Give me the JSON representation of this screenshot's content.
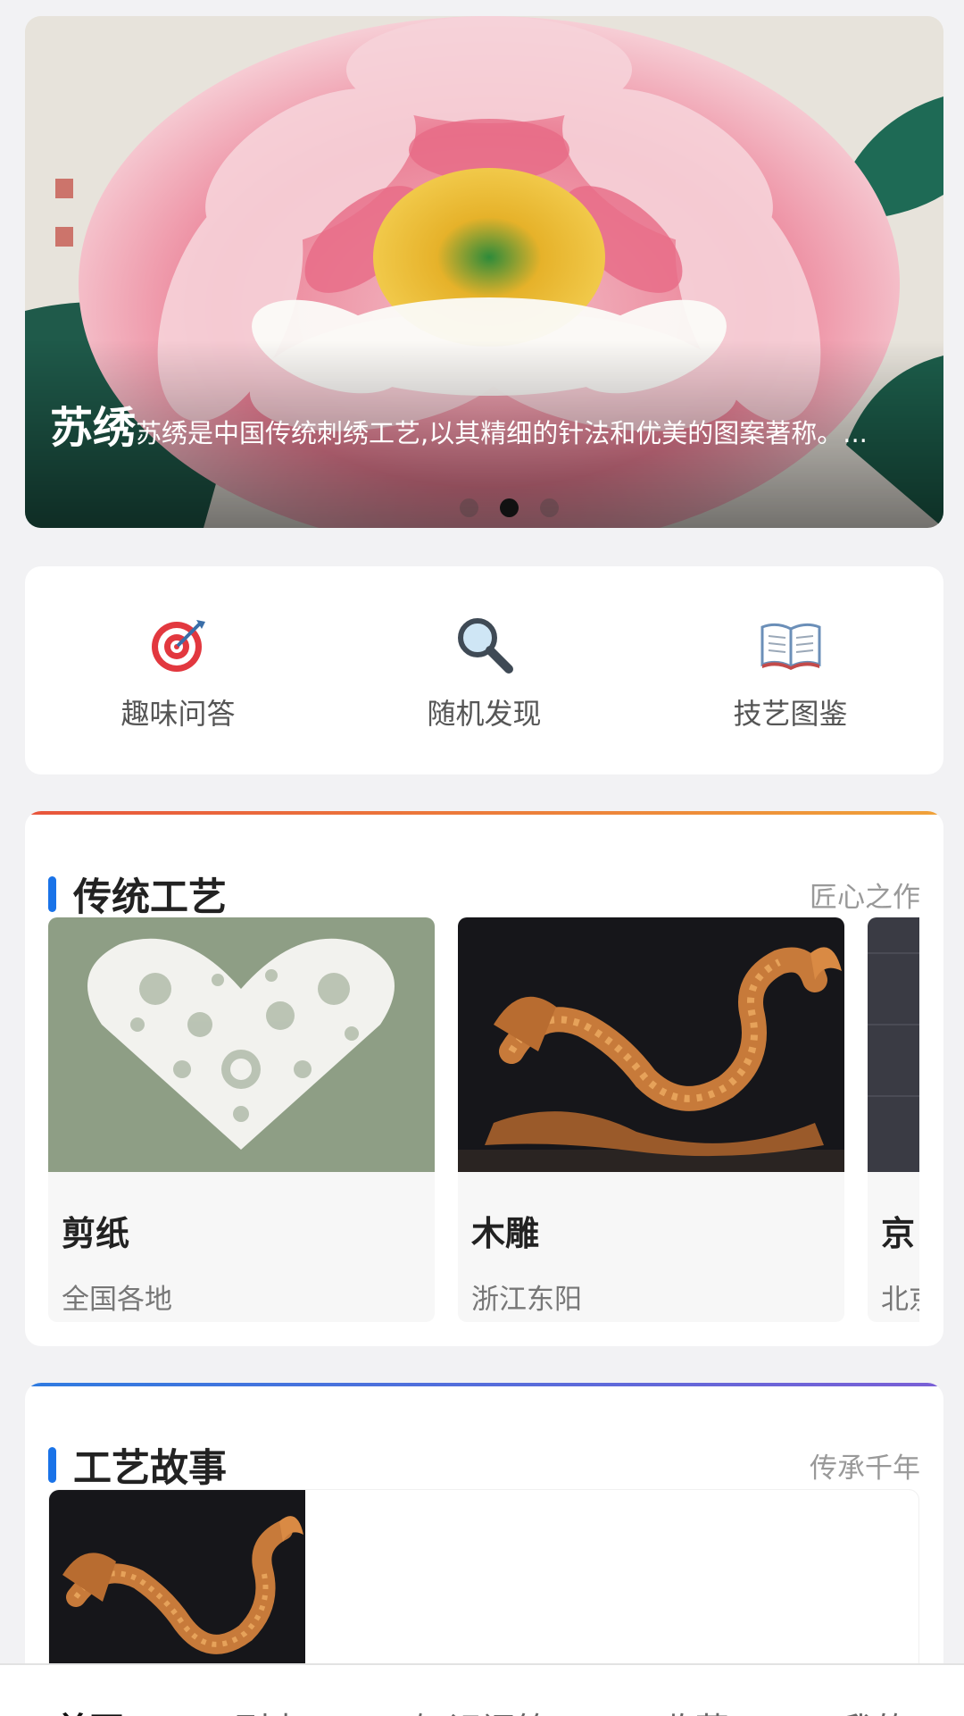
{
  "banner": {
    "title": "苏绣",
    "description": "苏绣是中国传统刺绣工艺,以其精细的针法和优美的图案著称。...",
    "image": "peony-embroidery",
    "slide_count": 3,
    "active_slide": 2
  },
  "quick_actions": [
    {
      "label": "趣味问答",
      "icon": "target-icon"
    },
    {
      "label": "随机发现",
      "icon": "magnifier-icon"
    },
    {
      "label": "技艺图鉴",
      "icon": "book-icon"
    }
  ],
  "crafts_section": {
    "title": "传统工艺",
    "subtitle": "匠心之作",
    "items": [
      {
        "name": "剪纸",
        "region": "全国各地",
        "image": "papercut-heart"
      },
      {
        "name": "木雕",
        "region": "浙江东阳",
        "image": "wooden-dragon"
      },
      {
        "name": "京",
        "region": "北京",
        "image": "dark-fabric"
      }
    ]
  },
  "stories_section": {
    "title": "工艺故事",
    "subtitle": "传承千年",
    "items": [
      {
        "image": "wooden-dragon"
      }
    ]
  },
  "tabbar": {
    "items": [
      "首页",
      "列表",
      "知识问答",
      "收藏",
      "我的"
    ],
    "active": 0
  },
  "colors": {
    "accent": "#1a73e8",
    "crafts_topline_start": "#e8553c",
    "crafts_topline_end": "#f0a23a",
    "stories_topline_start": "#2f7be0",
    "stories_topline_end": "#7a5fd6"
  }
}
